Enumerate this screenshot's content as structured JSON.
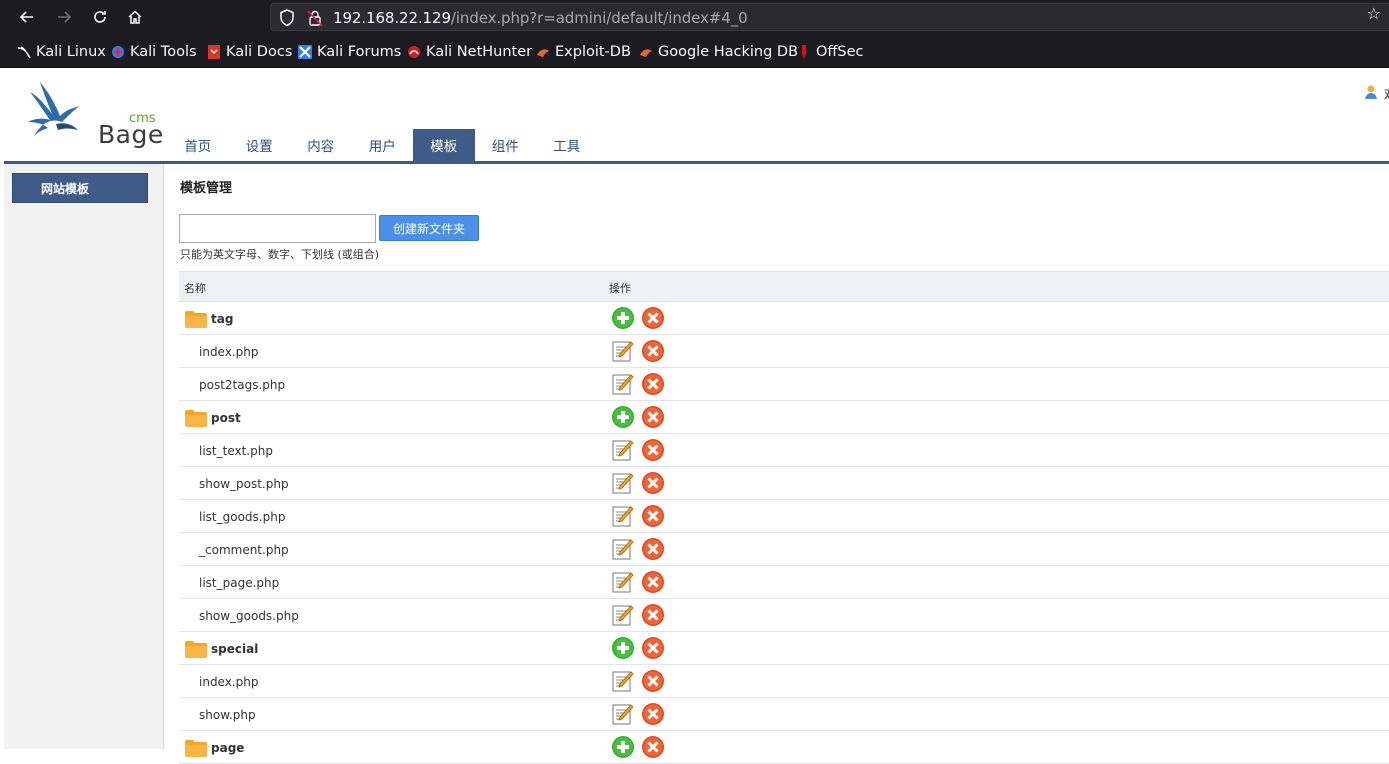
{
  "browser": {
    "url_host": "192.168.22.129",
    "url_path": "/index.php?r=admini/default/index#4_0",
    "bookmarks": [
      {
        "label": "Kali Linux",
        "icon": "kali-icon"
      },
      {
        "label": "Kali Tools",
        "icon": "kali-tools-icon"
      },
      {
        "label": "Kali Docs",
        "icon": "kali-docs-icon"
      },
      {
        "label": "Kali Forums",
        "icon": "kali-forums-icon"
      },
      {
        "label": "Kali NetHunter",
        "icon": "nethunter-icon"
      },
      {
        "label": "Exploit-DB",
        "icon": "exploitdb-icon"
      },
      {
        "label": "Google Hacking DB",
        "icon": "ghdb-icon"
      },
      {
        "label": "OffSec",
        "icon": "offsec-icon"
      }
    ]
  },
  "header": {
    "logo_text": "Bage",
    "logo_sub": "cms",
    "user_text": "欢",
    "menu": [
      "首页",
      "设置",
      "内容",
      "用户",
      "模板",
      "组件",
      "工具"
    ],
    "active_menu": "模板"
  },
  "sidebar": {
    "items": [
      {
        "label": "网站模板"
      }
    ]
  },
  "main": {
    "title": "模板管理",
    "input_value": "",
    "create_button": "创建新文件夹",
    "hint": "只能为英文字母、数字、下划线 (或组合)",
    "columns": {
      "name": "名称",
      "ops": "操作"
    },
    "rows": [
      {
        "type": "folder",
        "name": "tag"
      },
      {
        "type": "file",
        "name": "index.php"
      },
      {
        "type": "file",
        "name": "post2tags.php"
      },
      {
        "type": "folder",
        "name": "post"
      },
      {
        "type": "file",
        "name": "list_text.php"
      },
      {
        "type": "file",
        "name": "show_post.php"
      },
      {
        "type": "file",
        "name": "list_goods.php"
      },
      {
        "type": "file",
        "name": "_comment.php"
      },
      {
        "type": "file",
        "name": "list_page.php"
      },
      {
        "type": "file",
        "name": "show_goods.php"
      },
      {
        "type": "folder",
        "name": "special"
      },
      {
        "type": "file",
        "name": "index.php"
      },
      {
        "type": "file",
        "name": "show.php"
      },
      {
        "type": "folder",
        "name": "page"
      }
    ]
  },
  "colors": {
    "nav_active": "#3e5c87",
    "button": "#4a90e8",
    "folder": "#f5a623",
    "add": "#3aaa35",
    "delete": "#e85a32"
  }
}
